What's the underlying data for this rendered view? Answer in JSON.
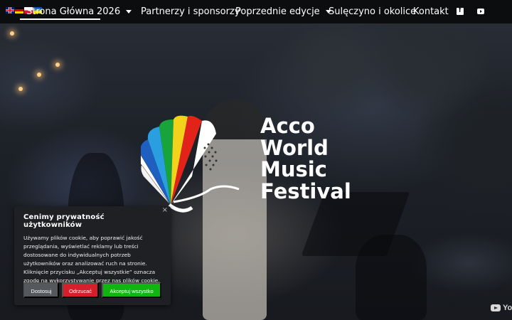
{
  "nav": {
    "items": [
      {
        "label": "Strona Główna",
        "active": true
      },
      {
        "label": "2026",
        "dropdown": true
      },
      {
        "label": "Partnerzy i sponsorzy"
      },
      {
        "label": "Poprzednie edycje",
        "dropdown": true
      },
      {
        "label": "Sulęczyno i okolice"
      },
      {
        "label": "Kontakt"
      }
    ],
    "flags": [
      "english-flag-icon",
      "german-flag-icon",
      "polish-flag-icon",
      "ukrainian-flag-icon"
    ],
    "social": [
      "facebook-icon",
      "youtube-icon"
    ]
  },
  "hero": {
    "title_lines": [
      "Acco",
      "World",
      "Music",
      "Festival"
    ],
    "logo": "accordion-butterfly-logo",
    "video_watermark": "YouTube"
  },
  "cookie_banner": {
    "title": "Cenimy prywatność użytkowników",
    "close": "×",
    "body_lines": [
      "Używamy plików cookie, aby poprawić jakość",
      "przeglądania, wyświetlać reklamy lub treści",
      "dostosowane do indywidualnych potrzeb",
      "użytkowników oraz analizować ruch na stronie.",
      "Kliknięcie przycisku „Akceptuj wszystkie” oznacza",
      "zgodę na wykorzystywanie przez nas plików cookie."
    ],
    "buttons": {
      "customize": "Dostosuj",
      "reject": "Odrzucać",
      "accept": "Akceptuj wszystko"
    }
  },
  "colors": {
    "nav_bg": "#0c0d0f",
    "reject": "#d61f2b",
    "accept": "#0fb60f",
    "customize": "#55585c"
  }
}
